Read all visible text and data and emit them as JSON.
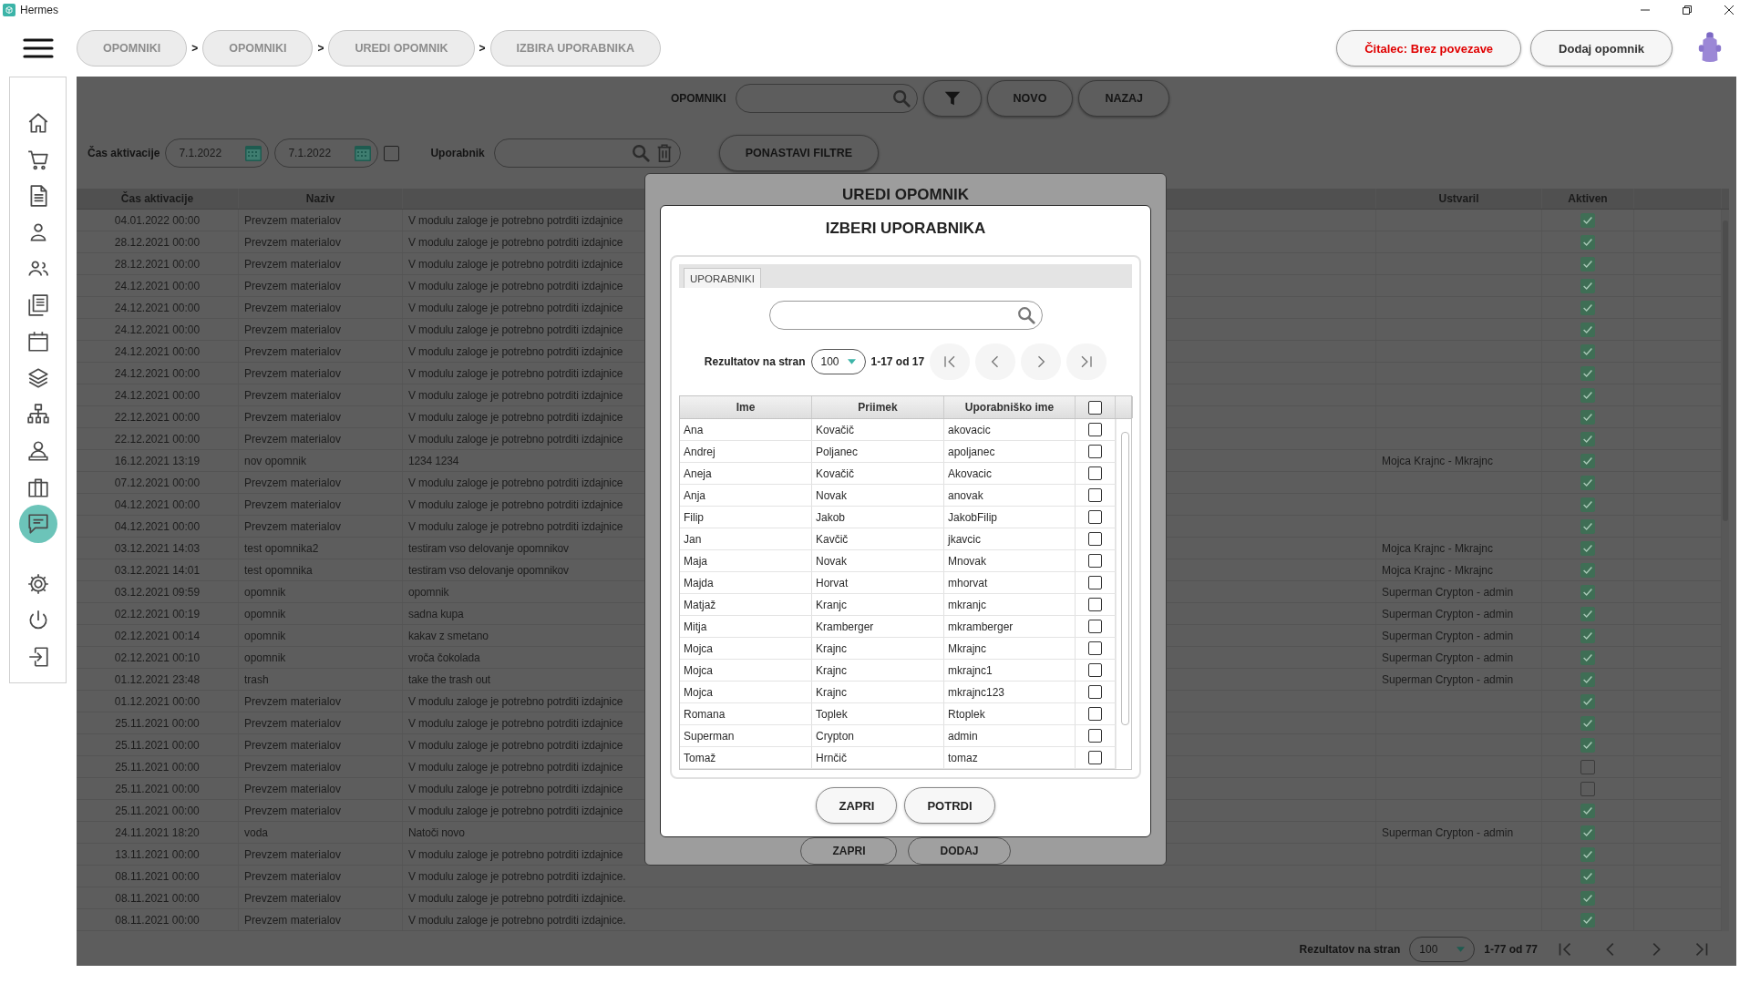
{
  "window": {
    "title": "Hermes"
  },
  "breadcrumbs": [
    {
      "label": "OPOMNIKI",
      "separator": ">"
    },
    {
      "label": "OPOMNIKI",
      "separator": ">"
    },
    {
      "label": "UREDI OPOMNIK",
      "separator": ">"
    },
    {
      "label": "IZBIRA UPORABNIKA"
    }
  ],
  "header_buttons": [
    {
      "label": "Čitalec: Brez povezave",
      "kind": "warning"
    },
    {
      "label": "Dodaj opomnik",
      "kind": "normal"
    }
  ],
  "sidebar": {
    "items": [
      {
        "selected": false
      },
      {
        "selected": false
      },
      {
        "selected": false
      },
      {
        "selected": false
      },
      {
        "selected": false
      },
      {
        "selected": false
      },
      {
        "selected": false
      },
      {
        "selected": false
      },
      {
        "selected": false
      },
      {
        "selected": false
      },
      {
        "selected": false
      },
      {
        "selected": true
      }
    ],
    "bottom_items": [
      {
        "selected": false
      },
      {
        "selected": false
      },
      {
        "selected": false
      }
    ]
  },
  "toolbar": {
    "label": "OPOMNIKI",
    "buttons": [
      {
        "label": "NOVO"
      },
      {
        "label": "NAZAJ"
      }
    ]
  },
  "filters": {
    "activation_label": "Čas aktivacije",
    "date_from": "7.1.2022",
    "date_to": "7.1.2022",
    "range_checked": false,
    "user_label": "Uporabnik",
    "reset_button": "PONASTAVI FILTRE"
  },
  "table": {
    "columns": [
      {
        "label": "Čas aktivacije"
      },
      {
        "label": "Naziv"
      },
      {
        "label": "Ustvaril"
      },
      {
        "label": "Aktiven"
      }
    ],
    "rows": [
      {
        "time": "04.01.2022 00:00",
        "name": "Prevzem materialov",
        "text": "V modulu zaloge je potrebno potrditi izdajnice",
        "active": true
      },
      {
        "time": "28.12.2021 00:00",
        "name": "Prevzem materialov",
        "text": "V modulu zaloge je potrebno potrditi izdajnice",
        "active": true
      },
      {
        "time": "28.12.2021 00:00",
        "name": "Prevzem materialov",
        "text": "V modulu zaloge je potrebno potrditi izdajnice",
        "active": true
      },
      {
        "time": "24.12.2021 00:00",
        "name": "Prevzem materialov",
        "text": "V modulu zaloge je potrebno potrditi izdajnice",
        "active": true
      },
      {
        "time": "24.12.2021 00:00",
        "name": "Prevzem materialov",
        "text": "V modulu zaloge je potrebno potrditi izdajnice",
        "active": true
      },
      {
        "time": "24.12.2021 00:00",
        "name": "Prevzem materialov",
        "text": "V modulu zaloge je potrebno potrditi izdajnice",
        "active": true
      },
      {
        "time": "24.12.2021 00:00",
        "name": "Prevzem materialov",
        "text": "V modulu zaloge je potrebno potrditi izdajnice",
        "active": true
      },
      {
        "time": "24.12.2021 00:00",
        "name": "Prevzem materialov",
        "text": "V modulu zaloge je potrebno potrditi izdajnice",
        "active": true
      },
      {
        "time": "24.12.2021 00:00",
        "name": "Prevzem materialov",
        "text": "V modulu zaloge je potrebno potrditi izdajnice",
        "active": true
      },
      {
        "time": "22.12.2021 00:00",
        "name": "Prevzem materialov",
        "text": "V modulu zaloge je potrebno potrditi izdajnice",
        "active": true
      },
      {
        "time": "22.12.2021 00:00",
        "name": "Prevzem materialov",
        "text": "V modulu zaloge je potrebno potrditi izdajnice",
        "active": true
      },
      {
        "time": "16.12.2021 13:19",
        "name": "nov opomnik",
        "text": "1234 1234",
        "creator": "Mojca Krajnc - Mkrajnc",
        "active": true
      },
      {
        "time": "07.12.2021 00:00",
        "name": "Prevzem materialov",
        "text": "V modulu zaloge je potrebno potrditi izdajnice",
        "active": true
      },
      {
        "time": "04.12.2021 00:00",
        "name": "Prevzem materialov",
        "text": "V modulu zaloge je potrebno potrditi izdajnice",
        "active": true
      },
      {
        "time": "04.12.2021 00:00",
        "name": "Prevzem materialov",
        "text": "V modulu zaloge je potrebno potrditi izdajnice",
        "active": true
      },
      {
        "time": "03.12.2021 14:03",
        "name": "test opomnika2",
        "text": "testiram vso delovanje opomnikov",
        "creator": "Mojca Krajnc - Mkrajnc",
        "active": true
      },
      {
        "time": "03.12.2021 14:01",
        "name": "test opomnika",
        "text": "testiram vso delovanje opomnikov",
        "creator": "Mojca Krajnc - Mkrajnc",
        "active": true
      },
      {
        "time": "03.12.2021 09:59",
        "name": "opomnik",
        "text": "opomnik",
        "creator": "Superman Crypton - admin",
        "active": true
      },
      {
        "time": "02.12.2021 00:19",
        "name": "opomnik",
        "text": "sadna kupa",
        "creator": "Superman Crypton - admin",
        "active": true
      },
      {
        "time": "02.12.2021 00:14",
        "name": "opomnik",
        "text": "kakav z smetano",
        "creator": "Superman Crypton - admin",
        "active": true
      },
      {
        "time": "02.12.2021 00:10",
        "name": "opomnik",
        "text": "vroča čokolada",
        "creator": "Superman Crypton - admin",
        "active": true
      },
      {
        "time": "01.12.2021 23:48",
        "name": "trash",
        "text": "take the trash out",
        "creator": "Superman Crypton - admin",
        "active": true
      },
      {
        "time": "01.12.2021 00:00",
        "name": "Prevzem materialov",
        "text": "V modulu zaloge je potrebno potrditi izdajnice",
        "active": true
      },
      {
        "time": "25.11.2021 00:00",
        "name": "Prevzem materialov",
        "text": "V modulu zaloge je potrebno potrditi izdajnice",
        "active": true
      },
      {
        "time": "25.11.2021 00:00",
        "name": "Prevzem materialov",
        "text": "V modulu zaloge je potrebno potrditi izdajnice",
        "active": true
      },
      {
        "time": "25.11.2021 00:00",
        "name": "Prevzem materialov",
        "text": "V modulu zaloge je potrebno potrditi izdajnice",
        "active": false
      },
      {
        "time": "25.11.2021 00:00",
        "name": "Prevzem materialov",
        "text": "V modulu zaloge je potrebno potrditi izdajnice",
        "active": false
      },
      {
        "time": "25.11.2021 00:00",
        "name": "Prevzem materialov",
        "text": "V modulu zaloge je potrebno potrditi izdajnice",
        "active": true
      },
      {
        "time": "24.11.2021 18:20",
        "name": "voda",
        "text": "Natoči novo",
        "creator": "Superman Crypton - admin",
        "active": true
      },
      {
        "time": "13.11.2021 00:00",
        "name": "Prevzem materialov",
        "text": "V modulu zaloge je potrebno potrditi izdajnice",
        "active": true
      },
      {
        "time": "08.11.2021 00:00",
        "name": "Prevzem materialov",
        "text": "V modulu zaloge je potrebno potrditi izdajnice.",
        "active": true
      },
      {
        "time": "08.11.2021 00:00",
        "name": "Prevzem materialov",
        "text": "V modulu zaloge je potrebno potrditi izdajnice.",
        "active": true
      },
      {
        "time": "08.11.2021 00:00",
        "name": "Prevzem materialov",
        "text": "V modulu zaloge je potrebno potrditi izdajnice.",
        "active": true
      }
    ]
  },
  "pagination": {
    "label": "Rezultatov na stran",
    "page_size": "100",
    "range": "1-77 od 77"
  },
  "edit_dialog": {
    "title": "UREDI OPOMNIK",
    "buttons": [
      "ZAPRI",
      "DODAJ"
    ]
  },
  "user_dialog": {
    "title": "IZBERI UPORABNIKA",
    "tabs": [
      {
        "label": "UPORABNIKI",
        "selected": true
      }
    ],
    "pagination": {
      "label": "Rezultatov na stran",
      "page_size": "100",
      "range": "1-17 od 17"
    },
    "columns": [
      "Ime",
      "Priimek",
      "Uporabniško ime"
    ],
    "select_all": false,
    "users": [
      {
        "first": "Ana",
        "last": "Kovačič",
        "username": "akovacic",
        "selected": false
      },
      {
        "first": "Andrej",
        "last": "Poljanec",
        "username": "apoljanec",
        "selected": false
      },
      {
        "first": "Aneja",
        "last": "Kovačič",
        "username": "Akovacic",
        "selected": false
      },
      {
        "first": "Anja",
        "last": "Novak",
        "username": "anovak",
        "selected": false
      },
      {
        "first": "Filip",
        "last": "Jakob",
        "username": "JakobFilip",
        "selected": false
      },
      {
        "first": "Jan",
        "last": "Kavčič",
        "username": "jkavcic",
        "selected": false
      },
      {
        "first": "Maja",
        "last": "Novak",
        "username": "Mnovak",
        "selected": false
      },
      {
        "first": "Majda",
        "last": "Horvat",
        "username": "mhorvat",
        "selected": false
      },
      {
        "first": "Matjaž",
        "last": "Kranjc",
        "username": "mkranjc",
        "selected": false
      },
      {
        "first": "Mitja",
        "last": "Kramberger",
        "username": "mkramberger",
        "selected": false
      },
      {
        "first": "Mojca",
        "last": "Krajnc",
        "username": "Mkrajnc",
        "selected": false
      },
      {
        "first": "Mojca",
        "last": "Krajnc",
        "username": "mkrajnc1",
        "selected": false
      },
      {
        "first": "Mojca",
        "last": "Krajnc",
        "username": "mkrajnc123",
        "selected": false
      },
      {
        "first": "Romana",
        "last": "Toplek",
        "username": "Rtoplek",
        "selected": false
      },
      {
        "first": "Superman",
        "last": "Crypton",
        "username": "admin",
        "selected": false
      },
      {
        "first": "Tomaž",
        "last": "Hrnčič",
        "username": "tomaz",
        "selected": false
      }
    ],
    "buttons": [
      "ZAPRI",
      "POTRDI"
    ]
  }
}
